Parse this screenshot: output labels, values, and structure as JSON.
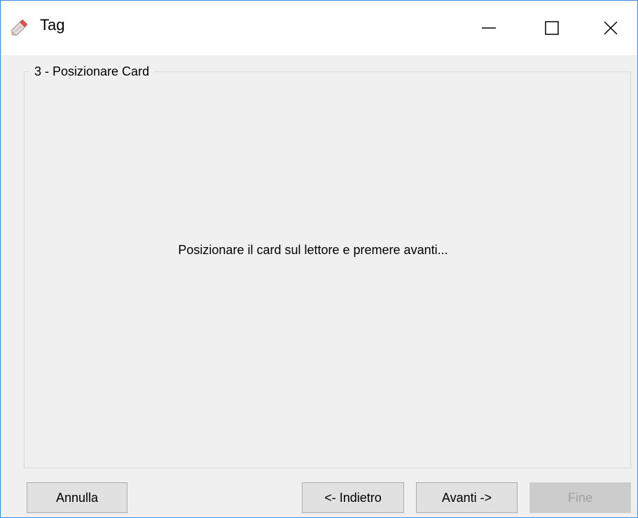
{
  "window": {
    "title": "Tag",
    "icon": "tag-pencil-icon",
    "controls": [
      "minimize-icon",
      "maximize-icon",
      "close-icon"
    ]
  },
  "group": {
    "legend": "3 - Posizionare Card",
    "message": "Posizionare il card sul lettore e premere avanti..."
  },
  "buttons": {
    "annulla": "Annulla",
    "indietro": "<- Indietro",
    "avanti": "Avanti ->",
    "fine": "Fine"
  },
  "colors": {
    "window_border": "#3c8ad8",
    "background": "#f0f0f0",
    "button_face": "#e1e1e1",
    "disabled_text": "#a0a0a0"
  }
}
